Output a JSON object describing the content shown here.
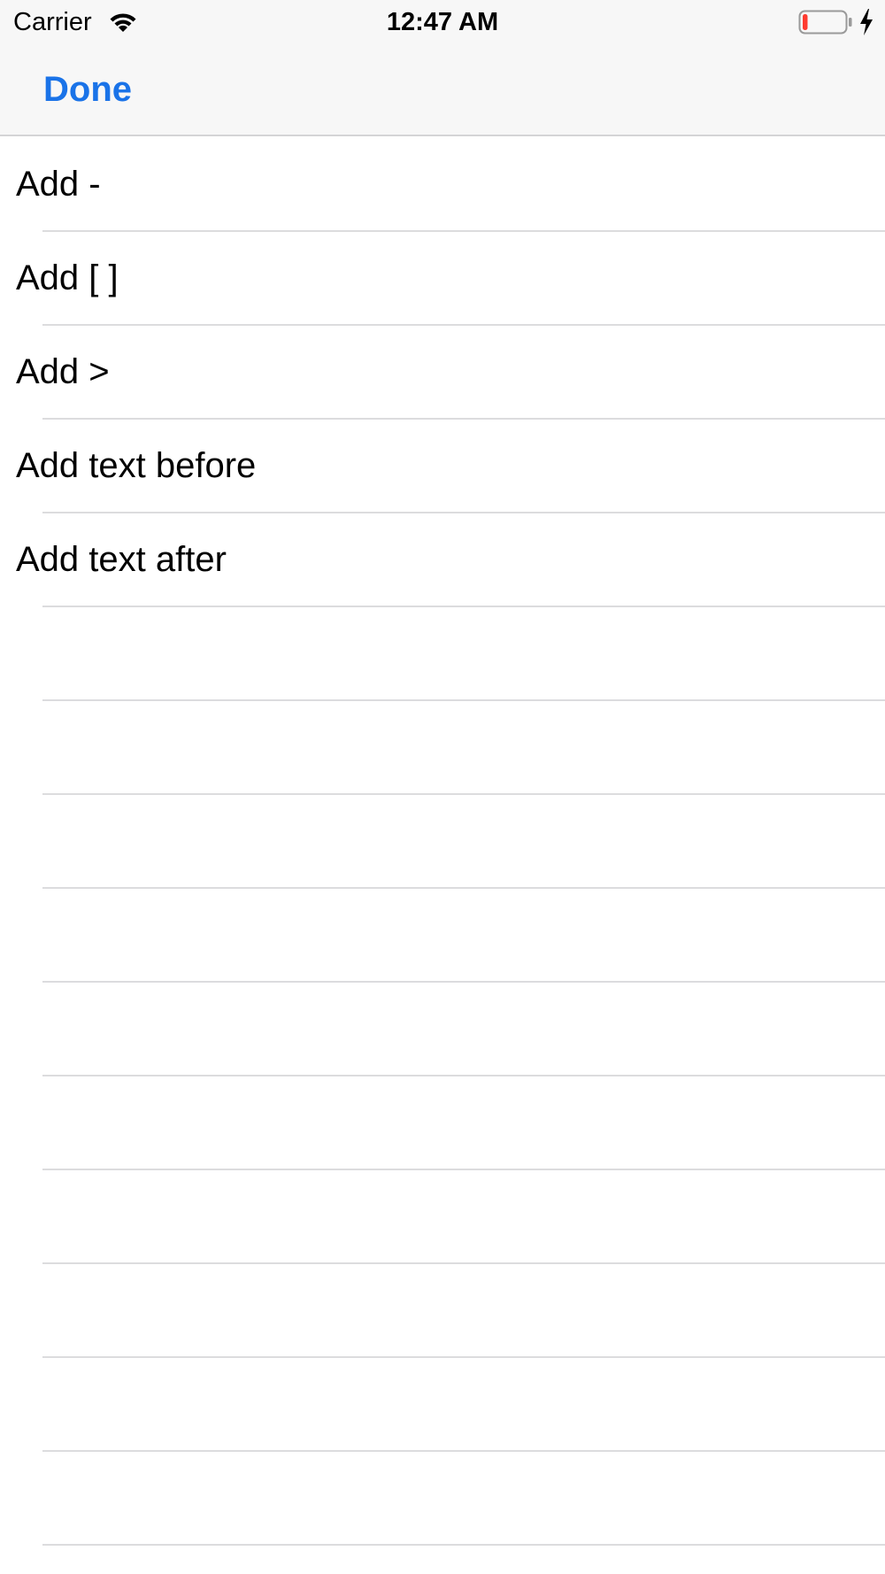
{
  "status_bar": {
    "carrier": "Carrier",
    "time": "12:47 AM",
    "wifi_icon": "wifi-icon",
    "battery_icon": "battery-low-icon",
    "charging_icon": "charging-bolt-icon",
    "battery_level": 0.12,
    "battery_color": "#ff3b30"
  },
  "nav": {
    "done_label": "Done",
    "accent_color": "#1a73e8"
  },
  "options": [
    {
      "label": "Add -"
    },
    {
      "label": "Add [ ]"
    },
    {
      "label": "Add >"
    },
    {
      "label": "Add text before"
    },
    {
      "label": "Add text after"
    }
  ],
  "empty_rows": 10
}
